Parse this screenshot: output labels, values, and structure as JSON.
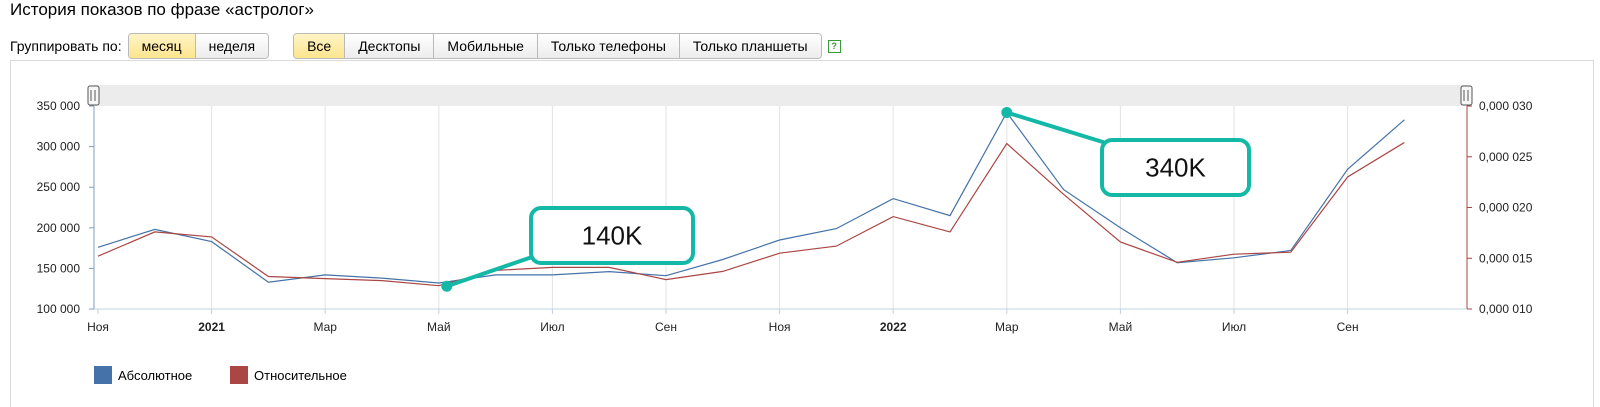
{
  "page": {
    "title": "История показов по фразе «астролог»",
    "group_label": "Группировать по:",
    "group_buttons": [
      {
        "label": "месяц",
        "active": true
      },
      {
        "label": "неделя",
        "active": false
      }
    ],
    "device_buttons": [
      {
        "label": "Все",
        "active": true
      },
      {
        "label": "Десктопы",
        "active": false
      },
      {
        "label": "Мобильные",
        "active": false
      },
      {
        "label": "Только телефоны",
        "active": false
      },
      {
        "label": "Только планшеты",
        "active": false
      }
    ],
    "help_label": "?"
  },
  "chart_data": {
    "type": "line",
    "x": [
      "2020-11",
      "2020-12",
      "2021-01",
      "2021-02",
      "2021-03",
      "2021-04",
      "2021-05",
      "2021-06",
      "2021-07",
      "2021-08",
      "2021-09",
      "2021-10",
      "2021-11",
      "2021-12",
      "2022-01",
      "2022-02",
      "2022-03",
      "2022-04",
      "2022-05",
      "2022-06",
      "2022-07",
      "2022-08",
      "2022-09",
      "2022-10"
    ],
    "x_tick_labels": [
      {
        "x": "2020-11",
        "label": "Ноя",
        "bold": false
      },
      {
        "x": "2021-01",
        "label": "2021",
        "bold": true
      },
      {
        "x": "2021-03",
        "label": "Мар",
        "bold": false
      },
      {
        "x": "2021-05",
        "label": "Май",
        "bold": false
      },
      {
        "x": "2021-07",
        "label": "Июл",
        "bold": false
      },
      {
        "x": "2021-09",
        "label": "Сен",
        "bold": false
      },
      {
        "x": "2021-11",
        "label": "Ноя",
        "bold": false
      },
      {
        "x": "2022-01",
        "label": "2022",
        "bold": true
      },
      {
        "x": "2022-03",
        "label": "Мар",
        "bold": false
      },
      {
        "x": "2022-05",
        "label": "Май",
        "bold": false
      },
      {
        "x": "2022-07",
        "label": "Июл",
        "bold": false
      },
      {
        "x": "2022-09",
        "label": "Сен",
        "bold": false
      }
    ],
    "series": [
      {
        "name": "Абсолютное",
        "axis": "left",
        "color": "#4572a7",
        "values": [
          176000,
          198000,
          183000,
          133000,
          142000,
          138000,
          132000,
          142000,
          142000,
          146000,
          141000,
          161000,
          185000,
          199000,
          236000,
          215000,
          342000,
          247000,
          200000,
          157000,
          163000,
          172000,
          272000,
          333000
        ]
      },
      {
        "name": "Относительное",
        "axis": "right",
        "color": "#aa4643",
        "values": [
          0.0152,
          0.0176,
          0.0171,
          0.0132,
          0.013,
          0.0128,
          0.0123,
          0.0138,
          0.0141,
          0.0141,
          0.0129,
          0.0137,
          0.0155,
          0.0162,
          0.0191,
          0.0176,
          0.0263,
          0.0213,
          0.0166,
          0.0146,
          0.0154,
          0.0156,
          0.023,
          0.0264
        ]
      }
    ],
    "y_left": {
      "min": 100000,
      "max": 350000,
      "ticks": [
        100000,
        150000,
        200000,
        250000,
        300000,
        350000
      ],
      "tick_labels": [
        "100 000",
        "150 000",
        "200 000",
        "250 000",
        "300 000",
        "350 000"
      ]
    },
    "y_right": {
      "min": 0.01,
      "max": 0.03,
      "ticks": [
        0.01,
        0.015,
        0.02,
        0.025,
        0.03
      ],
      "tick_labels": [
        "0,000 010",
        "0,000 015",
        "0,000 020",
        "0,000 025",
        "0,000 030"
      ]
    },
    "annotations": [
      {
        "text": "140K",
        "x": "2021-05",
        "y": 128000,
        "color": "#14b8a6"
      },
      {
        "text": "340K",
        "x": "2022-03",
        "y": 342000,
        "color": "#14b8a6"
      }
    ],
    "grid": true,
    "legend_position": "bottom-left"
  }
}
